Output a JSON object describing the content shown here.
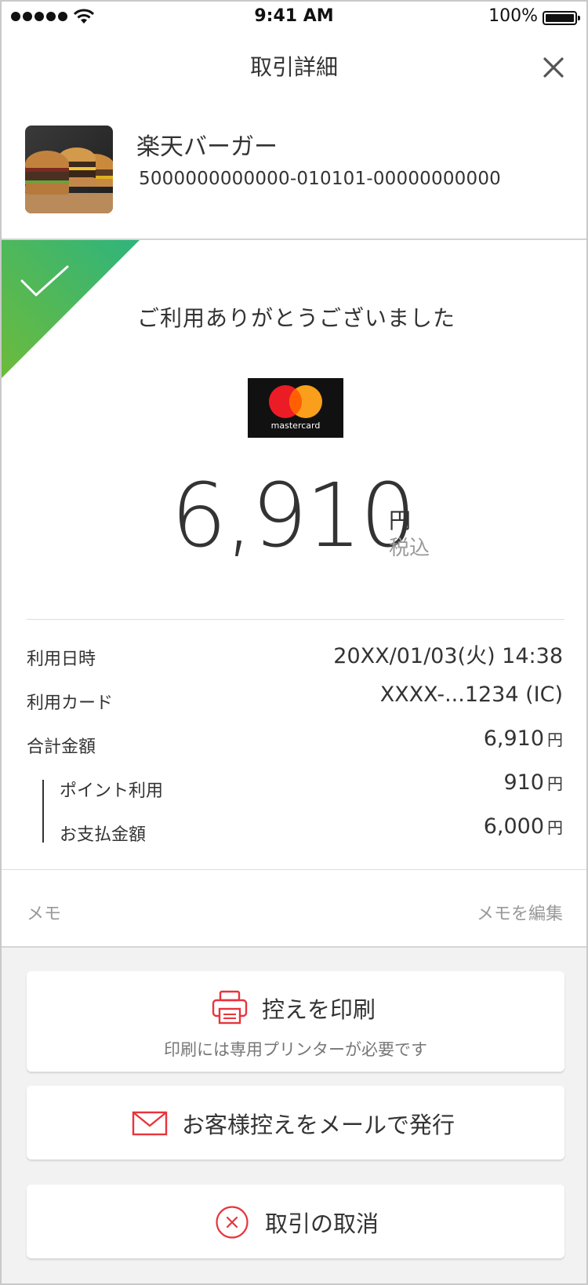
{
  "status_bar": {
    "time": "9:41 AM",
    "battery": "100%"
  },
  "header": {
    "title": "取引詳細"
  },
  "merchant": {
    "name": "楽天バーガー",
    "id": "5000000000000-010101-00000000000"
  },
  "result": {
    "message": "ご利用ありがとうございました",
    "card_brand": "mastercard"
  },
  "amount": {
    "value": "6,910",
    "currency": "円",
    "tax_note": "税込"
  },
  "details": {
    "date_label": "利用日時",
    "date_value": "20XX/01/03(火) 14:38",
    "card_label": "利用カード",
    "card_value": "XXXX-...1234 (IC)",
    "total_label": "合計金額",
    "total_value": "6,910",
    "points_label": "ポイント利用",
    "points_value": "910",
    "payment_label": "お支払金額",
    "payment_value": "6,000",
    "yen": "円"
  },
  "memo": {
    "label": "メモ",
    "edit": "メモを編集"
  },
  "actions": {
    "print_title": "控えを印刷",
    "print_sub": "印刷には専用プリンターが必要です",
    "mail_title": "お客様控えをメールで発行",
    "cancel_title": "取引の取消"
  },
  "colors": {
    "accent_red": "#e8343c",
    "success_green": "#4fb45a",
    "text": "#333333",
    "muted": "#999999"
  },
  "icons": [
    "signal-icon",
    "wifi-icon",
    "battery-icon",
    "close-icon",
    "check-icon",
    "mastercard-logo",
    "printer-icon",
    "mail-icon",
    "cancel-circle-icon"
  ]
}
